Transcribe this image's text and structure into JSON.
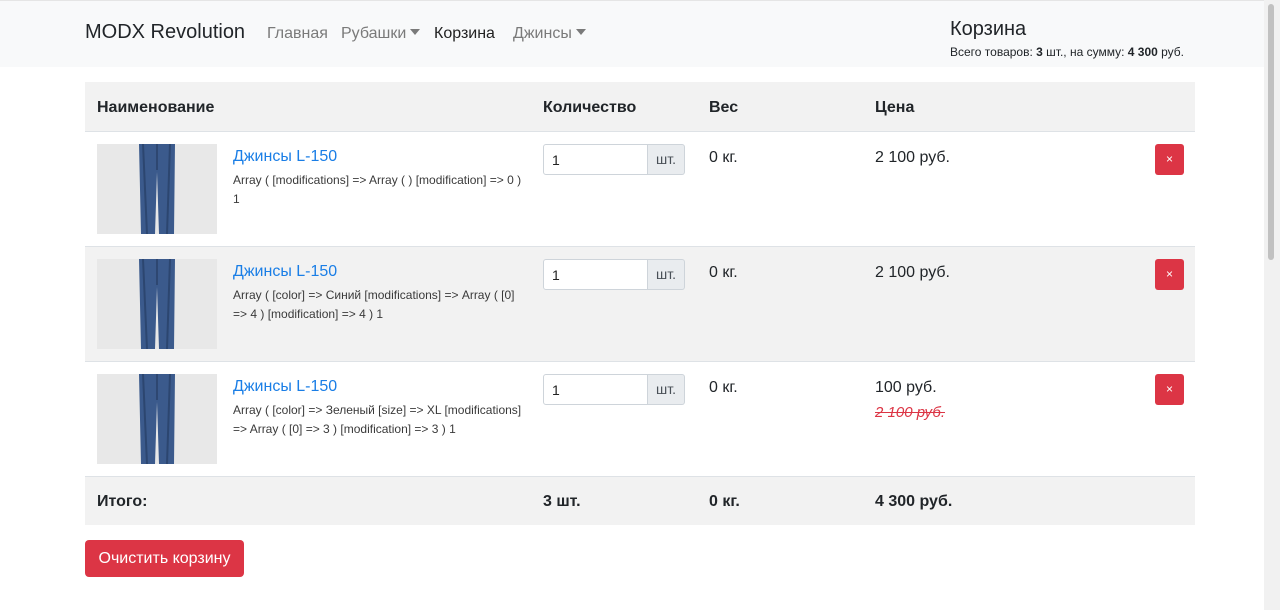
{
  "nav": {
    "brand": "MODX Revolution",
    "items": [
      {
        "label": "Главная"
      },
      {
        "label": "Рубашки"
      },
      {
        "label": "Корзина"
      },
      {
        "label": "Джинсы"
      }
    ]
  },
  "mini_cart": {
    "title": "Корзина",
    "summary_prefix": "Всего товаров: ",
    "count": "3",
    "summary_mid": " шт., на сумму: ",
    "total": "4 300",
    "summary_suffix": " руб."
  },
  "table": {
    "headers": {
      "name": "Наименование",
      "qty": "Количество",
      "weight": "Вес",
      "price": "Цена"
    },
    "unit": "шт.",
    "delete_label": "×",
    "rows": [
      {
        "name": "Джинсы L-150",
        "options": "Array ( [modifications] => Array ( ) [modification] => 0 ) 1",
        "qty": "1",
        "weight": "0 кг.",
        "price": "2 100 руб.",
        "old_price": ""
      },
      {
        "name": "Джинсы L-150",
        "options": "Array ( [color] => Синий [modifications] => Array ( [0] => 4 ) [modification] => 4 ) 1",
        "qty": "1",
        "weight": "0 кг.",
        "price": "2 100 руб.",
        "old_price": ""
      },
      {
        "name": "Джинсы L-150",
        "options": "Array ( [color] => Зеленый [size] => XL [modifications] => Array ( [0] => 3 ) [modification] => 3 ) 1",
        "qty": "1",
        "weight": "0 кг.",
        "price": "100 руб.",
        "old_price": "2 100 руб."
      }
    ],
    "footer": {
      "label": "Итого:",
      "qty": "3 шт.",
      "weight": "0 кг.",
      "price": "4 300 руб."
    }
  },
  "clear_button": "Очистить корзину",
  "colors": {
    "link": "#1a7ee6",
    "danger": "#dc3545",
    "navbar": "#f8f9fa"
  }
}
